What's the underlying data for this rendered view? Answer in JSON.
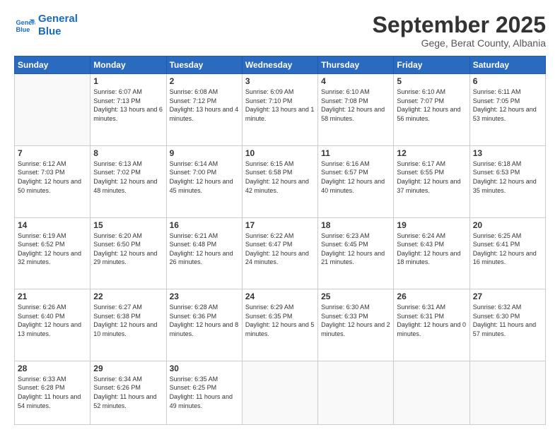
{
  "logo": {
    "line1": "General",
    "line2": "Blue"
  },
  "title": "September 2025",
  "subtitle": "Gege, Berat County, Albania",
  "weekdays": [
    "Sunday",
    "Monday",
    "Tuesday",
    "Wednesday",
    "Thursday",
    "Friday",
    "Saturday"
  ],
  "weeks": [
    [
      null,
      {
        "day": "1",
        "sunrise": "6:07 AM",
        "sunset": "7:13 PM",
        "daylight": "13 hours and 6 minutes."
      },
      {
        "day": "2",
        "sunrise": "6:08 AM",
        "sunset": "7:12 PM",
        "daylight": "13 hours and 4 minutes."
      },
      {
        "day": "3",
        "sunrise": "6:09 AM",
        "sunset": "7:10 PM",
        "daylight": "13 hours and 1 minute."
      },
      {
        "day": "4",
        "sunrise": "6:10 AM",
        "sunset": "7:08 PM",
        "daylight": "12 hours and 58 minutes."
      },
      {
        "day": "5",
        "sunrise": "6:10 AM",
        "sunset": "7:07 PM",
        "daylight": "12 hours and 56 minutes."
      },
      {
        "day": "6",
        "sunrise": "6:11 AM",
        "sunset": "7:05 PM",
        "daylight": "12 hours and 53 minutes."
      }
    ],
    [
      {
        "day": "7",
        "sunrise": "6:12 AM",
        "sunset": "7:03 PM",
        "daylight": "12 hours and 50 minutes."
      },
      {
        "day": "8",
        "sunrise": "6:13 AM",
        "sunset": "7:02 PM",
        "daylight": "12 hours and 48 minutes."
      },
      {
        "day": "9",
        "sunrise": "6:14 AM",
        "sunset": "7:00 PM",
        "daylight": "12 hours and 45 minutes."
      },
      {
        "day": "10",
        "sunrise": "6:15 AM",
        "sunset": "6:58 PM",
        "daylight": "12 hours and 42 minutes."
      },
      {
        "day": "11",
        "sunrise": "6:16 AM",
        "sunset": "6:57 PM",
        "daylight": "12 hours and 40 minutes."
      },
      {
        "day": "12",
        "sunrise": "6:17 AM",
        "sunset": "6:55 PM",
        "daylight": "12 hours and 37 minutes."
      },
      {
        "day": "13",
        "sunrise": "6:18 AM",
        "sunset": "6:53 PM",
        "daylight": "12 hours and 35 minutes."
      }
    ],
    [
      {
        "day": "14",
        "sunrise": "6:19 AM",
        "sunset": "6:52 PM",
        "daylight": "12 hours and 32 minutes."
      },
      {
        "day": "15",
        "sunrise": "6:20 AM",
        "sunset": "6:50 PM",
        "daylight": "12 hours and 29 minutes."
      },
      {
        "day": "16",
        "sunrise": "6:21 AM",
        "sunset": "6:48 PM",
        "daylight": "12 hours and 26 minutes."
      },
      {
        "day": "17",
        "sunrise": "6:22 AM",
        "sunset": "6:47 PM",
        "daylight": "12 hours and 24 minutes."
      },
      {
        "day": "18",
        "sunrise": "6:23 AM",
        "sunset": "6:45 PM",
        "daylight": "12 hours and 21 minutes."
      },
      {
        "day": "19",
        "sunrise": "6:24 AM",
        "sunset": "6:43 PM",
        "daylight": "12 hours and 18 minutes."
      },
      {
        "day": "20",
        "sunrise": "6:25 AM",
        "sunset": "6:41 PM",
        "daylight": "12 hours and 16 minutes."
      }
    ],
    [
      {
        "day": "21",
        "sunrise": "6:26 AM",
        "sunset": "6:40 PM",
        "daylight": "12 hours and 13 minutes."
      },
      {
        "day": "22",
        "sunrise": "6:27 AM",
        "sunset": "6:38 PM",
        "daylight": "12 hours and 10 minutes."
      },
      {
        "day": "23",
        "sunrise": "6:28 AM",
        "sunset": "6:36 PM",
        "daylight": "12 hours and 8 minutes."
      },
      {
        "day": "24",
        "sunrise": "6:29 AM",
        "sunset": "6:35 PM",
        "daylight": "12 hours and 5 minutes."
      },
      {
        "day": "25",
        "sunrise": "6:30 AM",
        "sunset": "6:33 PM",
        "daylight": "12 hours and 2 minutes."
      },
      {
        "day": "26",
        "sunrise": "6:31 AM",
        "sunset": "6:31 PM",
        "daylight": "12 hours and 0 minutes."
      },
      {
        "day": "27",
        "sunrise": "6:32 AM",
        "sunset": "6:30 PM",
        "daylight": "11 hours and 57 minutes."
      }
    ],
    [
      {
        "day": "28",
        "sunrise": "6:33 AM",
        "sunset": "6:28 PM",
        "daylight": "11 hours and 54 minutes."
      },
      {
        "day": "29",
        "sunrise": "6:34 AM",
        "sunset": "6:26 PM",
        "daylight": "11 hours and 52 minutes."
      },
      {
        "day": "30",
        "sunrise": "6:35 AM",
        "sunset": "6:25 PM",
        "daylight": "11 hours and 49 minutes."
      },
      null,
      null,
      null,
      null
    ]
  ]
}
